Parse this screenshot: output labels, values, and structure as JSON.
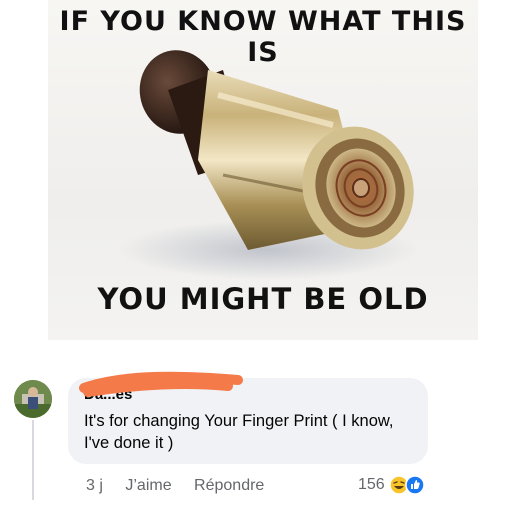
{
  "meme": {
    "top_text": "IF YOU KNOW WHAT THIS IS",
    "bottom_text": "YOU MIGHT BE OLD"
  },
  "comment": {
    "author": "Da...es",
    "text": "It's for changing Your Finger Print ( I know, I've done it )",
    "time": "3 j",
    "like_label": "J’aime",
    "reply_label": "Répondre",
    "reaction_count": "156",
    "reaction_icons": [
      "haha-icon",
      "like-icon"
    ],
    "redaction_color": "#f47a4a"
  }
}
